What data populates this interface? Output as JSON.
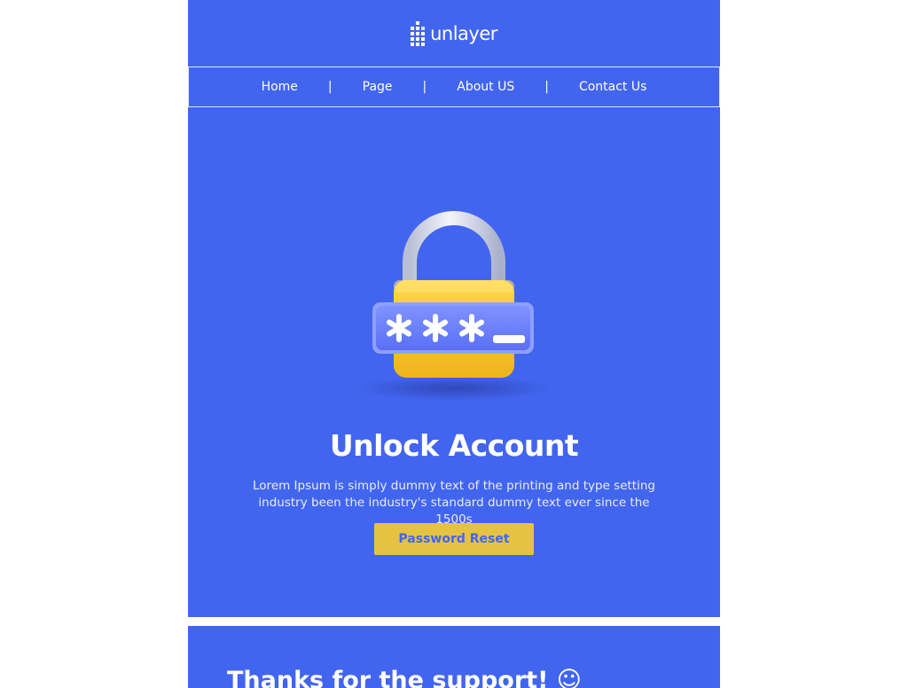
{
  "brand": {
    "name": "unlayer"
  },
  "nav": {
    "items": [
      "Home",
      "Page",
      "About US",
      "Contact Us"
    ],
    "separator": "|"
  },
  "hero": {
    "title": "Unlock Account",
    "description": "Lorem Ipsum is simply dummy text of the printing and type setting industry been the industry's standard dummy text ever since the 1500s",
    "button_label": "Password Reset",
    "illustration": "padlock-password-icon"
  },
  "footer": {
    "title": "Thanks for the support! ☺"
  },
  "colors": {
    "primary": "#4265ef",
    "button": "#e6c243",
    "lock_body": "#f5c431",
    "page_bg": "#ffffff"
  }
}
